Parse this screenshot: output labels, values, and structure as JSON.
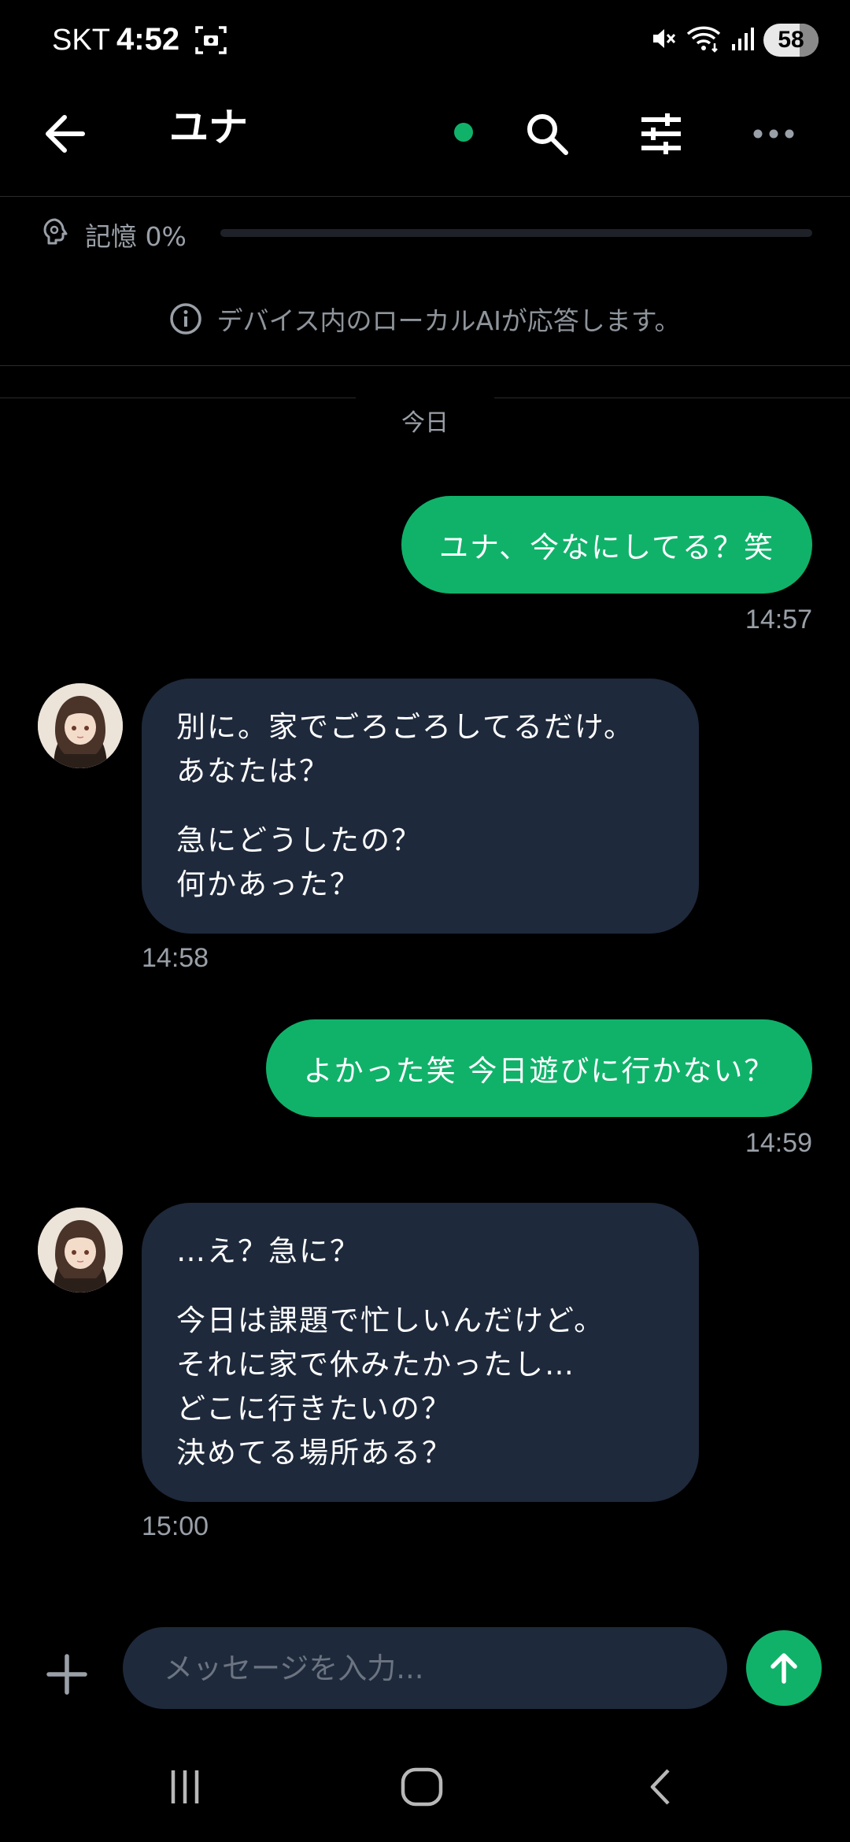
{
  "status_bar": {
    "carrier": "SKT",
    "time": "4:52",
    "battery": "58",
    "icons": [
      "screenshot-icon",
      "mute-icon",
      "wifi-icon",
      "signal-icon",
      "battery-icon"
    ]
  },
  "header": {
    "title": "ユナ",
    "online_color": "#10b26a",
    "icons": [
      "back-arrow-icon",
      "search-icon",
      "sliders-icon",
      "more-icon"
    ]
  },
  "memory": {
    "label": "記憶 0%",
    "progress": 0
  },
  "notice": {
    "text": "デバイス内のローカルAIが応答します。"
  },
  "date_separator": "今日",
  "messages": [
    {
      "sender": "user",
      "text": "ユナ、今なにしてる？笑",
      "time": "14:57"
    },
    {
      "sender": "ai",
      "paragraphs": [
        [
          "別に。家でごろごろしてるだけ。",
          "あなたは？"
        ],
        [
          "急にどうしたの？",
          "何かあった？"
        ]
      ],
      "time": "14:58"
    },
    {
      "sender": "user",
      "text": "よかった笑 今日遊びに行かない？",
      "time": "14:59"
    },
    {
      "sender": "ai",
      "paragraphs": [
        [
          "…え？急に？"
        ],
        [
          "今日は課題で忙しいんだけど。",
          "それに家で休みたかったし…",
          "どこに行きたいの？",
          "決めてる場所ある？"
        ]
      ],
      "time": "15:00"
    }
  ],
  "composer": {
    "placeholder": "メッセージを入力..."
  },
  "colors": {
    "accent": "#10b26a",
    "ai_bubble": "#1e293b",
    "background": "#000000"
  },
  "nav_bar": {
    "icons": [
      "recents-icon",
      "home-icon",
      "back-icon"
    ]
  }
}
